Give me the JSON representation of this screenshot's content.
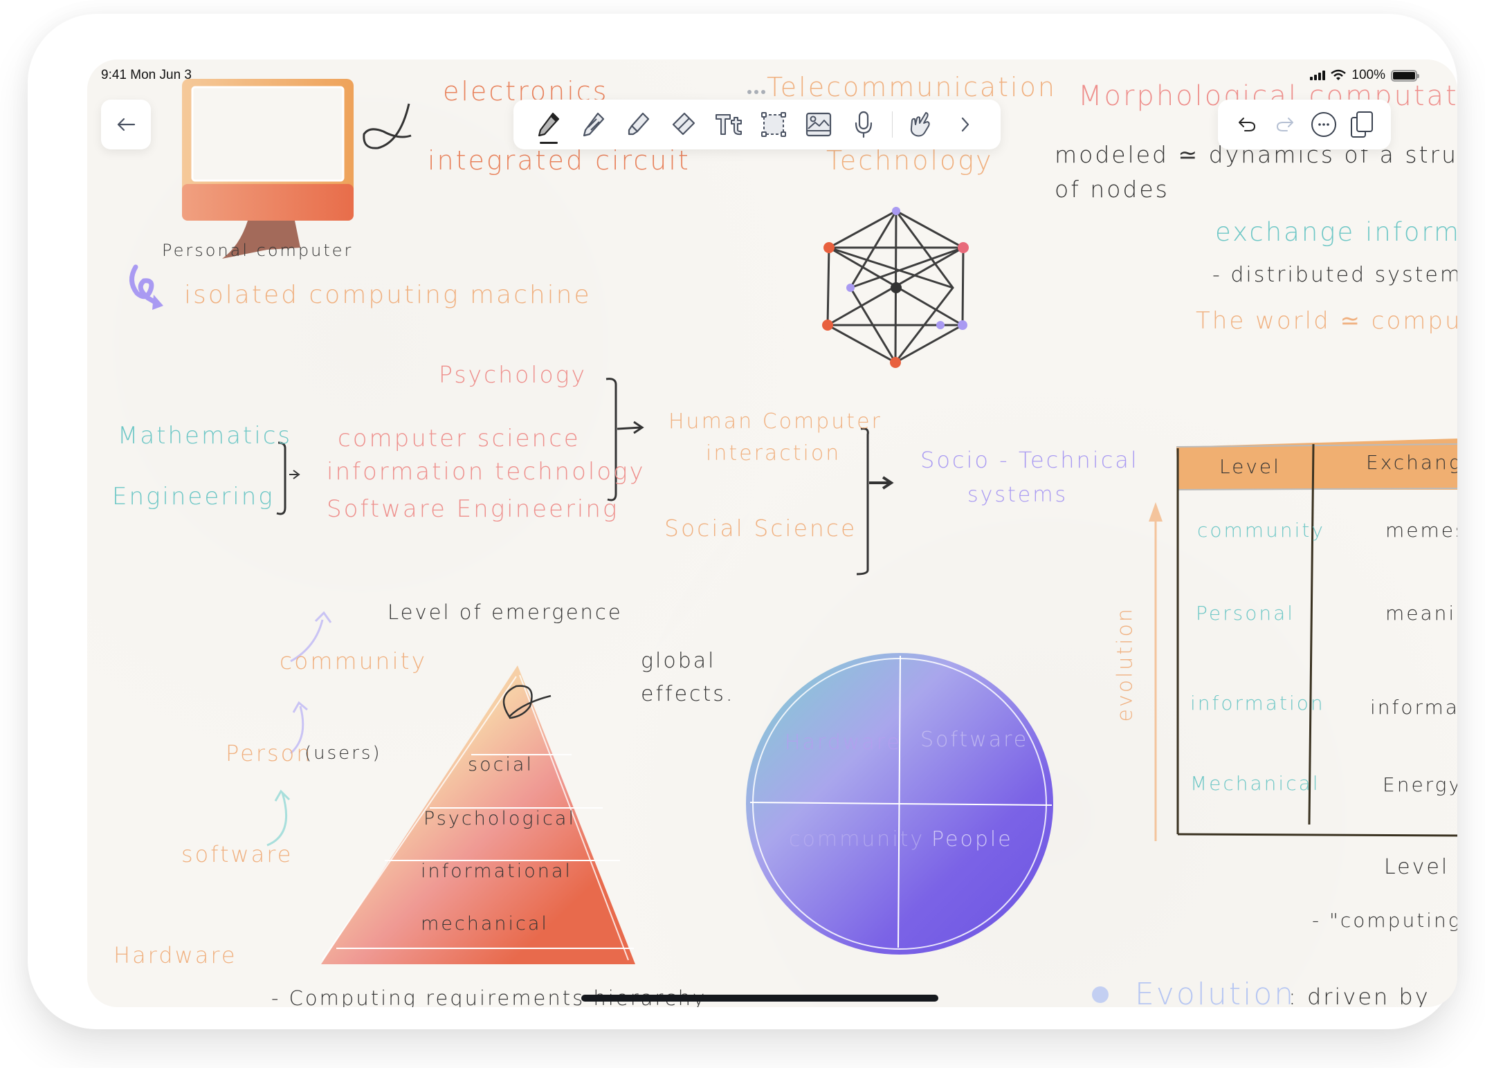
{
  "status_bar": {
    "time": "9:41",
    "date": "Mon Jun 3",
    "battery": "100%",
    "battery_level": 1.0,
    "icons": [
      "signal-icon",
      "wifi-icon",
      "battery-icon"
    ]
  },
  "nav": {
    "back_icon": "arrow-left-icon"
  },
  "toolbar": {
    "tools": [
      {
        "name": "pen",
        "icon": "pen-icon",
        "active": true
      },
      {
        "name": "pencil",
        "icon": "pencil-icon",
        "active": false
      },
      {
        "name": "highlighter",
        "icon": "highlighter-icon",
        "active": false
      },
      {
        "name": "eraser",
        "icon": "eraser-icon",
        "active": false
      },
      {
        "name": "text",
        "icon": "text-icon",
        "label": "Tt",
        "active": false
      },
      {
        "name": "lasso",
        "icon": "selection-icon",
        "active": false
      },
      {
        "name": "image",
        "icon": "image-icon",
        "active": false
      },
      {
        "name": "audio",
        "icon": "microphone-icon",
        "active": false
      },
      {
        "name": "gesture",
        "icon": "hand-pointer-icon",
        "active": false
      },
      {
        "name": "more",
        "icon": "chevron-right-icon",
        "active": false
      }
    ]
  },
  "right_toolbar": {
    "items": [
      {
        "name": "undo",
        "icon": "undo-icon",
        "enabled": true
      },
      {
        "name": "redo",
        "icon": "redo-icon",
        "enabled": false
      },
      {
        "name": "more",
        "icon": "ellipsis-circle-icon",
        "enabled": true
      },
      {
        "name": "pages",
        "icon": "pages-icon",
        "enabled": true
      }
    ]
  },
  "canvas": {
    "top_left": {
      "illustration": "personal-computer-drawing",
      "caption": "Personal computer",
      "arrow_text": "isolated computing machine"
    },
    "top_middle": {
      "line1": "electronics",
      "line2": "integrated circuit",
      "line3": "Telecommunication",
      "line4": "Technology"
    },
    "top_right": {
      "heading": "Morphological computation",
      "body_line1": "modeled ≃ dynamics of a structu",
      "body_line2": "of nodes",
      "exchange": "exchange informa",
      "distributed": "- distributed systems",
      "world": "The world ≃ computer"
    },
    "network": {
      "illustration": "network-graph-drawing"
    },
    "disciplines": {
      "left": [
        "Mathematics",
        "Engineering"
      ],
      "middle": [
        "computer science",
        "information technology",
        "Software Engineering"
      ],
      "top": "Psychology",
      "hci_line1": "Human Computer",
      "hci_line2": "interaction",
      "social": "Social Science",
      "result_line1": "Socio - Technical",
      "result_line2": "systems"
    },
    "emergence": {
      "title": "Level of emergence",
      "ladder": [
        "community",
        "Person",
        "software",
        "Hardware"
      ],
      "person_note": "(users)",
      "pyramid_layers": [
        "social",
        "Psychological",
        "informational",
        "mechanical"
      ],
      "global_line1": "global",
      "global_line2": "effects.",
      "footer": "-  Computing requirements hierarchy -"
    },
    "globe": {
      "quadrants": [
        "Hardware",
        "Software",
        "community",
        "People"
      ]
    },
    "table": {
      "headers": [
        "Level",
        "Exchang"
      ],
      "rows": [
        [
          "community",
          "memes"
        ],
        [
          "Personal",
          "meanin"
        ],
        [
          "information",
          "informati"
        ],
        [
          "Mechanical",
          "Energy"
        ]
      ],
      "axis_label": "evolution",
      "footer_label": "Level",
      "quote": "- \"computing i"
    },
    "bottom_right": {
      "keyword": "Evolution",
      "rest": ": driven by"
    }
  }
}
